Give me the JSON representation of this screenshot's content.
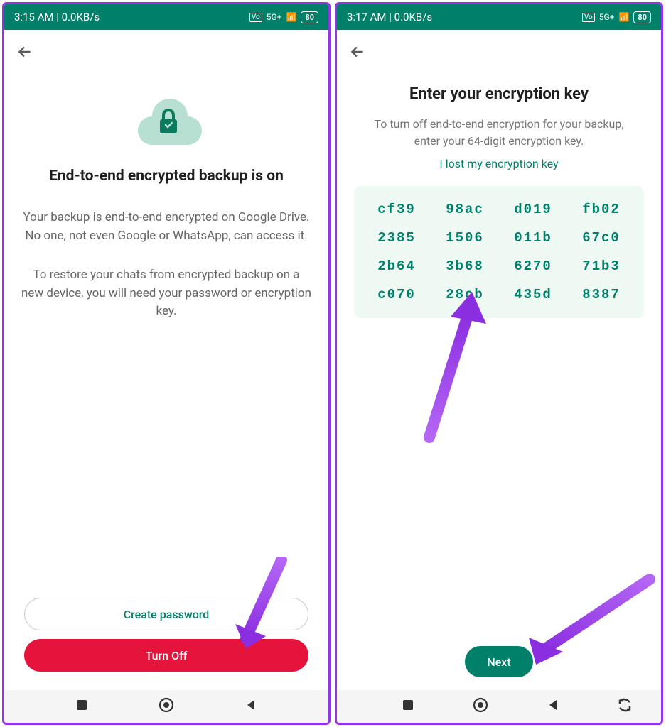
{
  "left": {
    "status": {
      "time": "3:15 AM | 0.0KB/s",
      "network": "5G+",
      "battery": "80"
    },
    "title": "End-to-end encrypted backup is on",
    "desc1": "Your backup is end-to-end encrypted on Google Drive. No one, not even Google or WhatsApp, can access it.",
    "desc2": "To restore your chats from encrypted backup on a new device, you will need your password or encryption key.",
    "create_password": "Create password",
    "turn_off": "Turn Off"
  },
  "right": {
    "status": {
      "time": "3:17 AM | 0.0KB/s",
      "network": "5G+",
      "battery": "80"
    },
    "title": "Enter your encryption key",
    "desc": "To turn off end-to-end encryption for your backup, enter your 64-digit encryption key.",
    "lost_link": "I lost my encryption key",
    "key": [
      "cf39",
      "98ac",
      "d019",
      "fb02",
      "2385",
      "1506",
      "011b",
      "67c0",
      "2b64",
      "3b68",
      "6270",
      "71b3",
      "c070",
      "28cb",
      "435d",
      "8387"
    ],
    "next": "Next"
  }
}
